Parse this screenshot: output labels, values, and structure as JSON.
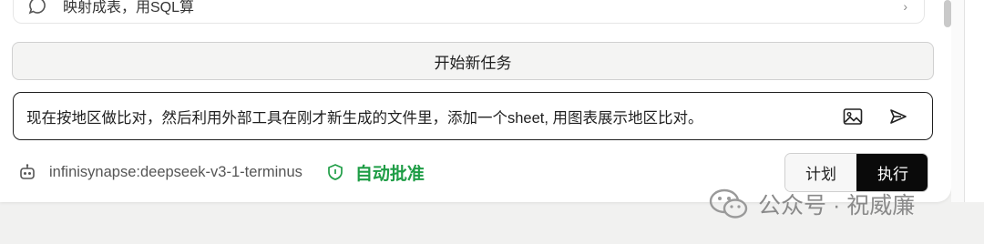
{
  "previous_item": {
    "text": "映射成表，用SQL算",
    "icon": "chat-bubble-icon"
  },
  "new_task_button": {
    "label": "开始新任务"
  },
  "prompt_input": {
    "value": "现在按地区做比对，然后利用外部工具在刚才新生成的文件里，添加一个sheet, 用图表展示地区比对。",
    "image_icon": "image-icon",
    "send_icon": "send-icon"
  },
  "model": {
    "icon": "robot-icon",
    "name": "infinisynapse:deepseek-v3-1-terminus"
  },
  "auto_approve": {
    "icon": "shield-icon",
    "label": "自动批准",
    "color": "#1f9d46"
  },
  "mode_toggle": {
    "plan_label": "计划",
    "execute_label": "执行",
    "selected": "执行"
  },
  "watermark": {
    "icon": "wechat-icon",
    "text": "公众号 · 祝威廉"
  }
}
